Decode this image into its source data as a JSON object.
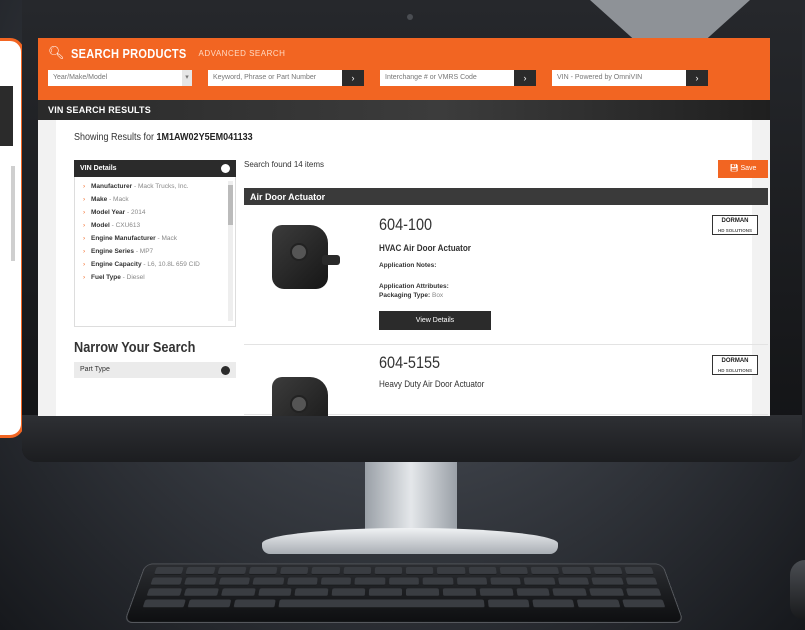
{
  "search": {
    "title": "SEARCH PRODUCTS",
    "advanced_label": "ADVANCED SEARCH",
    "ymm_placeholder": "Year/Make/Model",
    "keyword_placeholder": "Keyword, Phrase or Part Number",
    "interchange_placeholder": "Interchange # or VMRS Code",
    "vin_placeholder": "VIN - Powered by OmniVIN",
    "go_label": "›"
  },
  "results_strip": "VIN SEARCH RESULTS",
  "showing": {
    "prefix": "Showing Results for",
    "vin": "1M1AW02Y5EM041133"
  },
  "vin_details": {
    "title": "VIN Details",
    "items": [
      {
        "label": "Manufacturer",
        "value": "- Mack Trucks, Inc."
      },
      {
        "label": "Make",
        "value": "- Mack"
      },
      {
        "label": "Model Year",
        "value": "- 2014"
      },
      {
        "label": "Model",
        "value": "- CXU613"
      },
      {
        "label": "Engine Manufacturer",
        "value": "- Mack"
      },
      {
        "label": "Engine Series",
        "value": "- MP7"
      },
      {
        "label": "Engine Capacity",
        "value": "- L6, 10.8L 659 CID"
      },
      {
        "label": "Fuel Type",
        "value": "- Diesel"
      }
    ]
  },
  "narrow": {
    "title": "Narrow Your Search",
    "part_type_label": "Part Type"
  },
  "results": {
    "found_text": "Search found 14 items",
    "save_label": "Save",
    "category": "Air Door Actuator",
    "products": [
      {
        "number": "604-100",
        "name": "HVAC Air Door Actuator",
        "notes_label": "Application Notes:",
        "attributes_label": "Application Attributes:",
        "packaging_label": "Packaging Type:",
        "packaging_value": "Box",
        "view_label": "View Details",
        "brand": "DORMAN",
        "brand_sub": "HD SOLUTIONS"
      },
      {
        "number": "604-5155",
        "name": "Heavy Duty Air Door Actuator",
        "brand": "DORMAN",
        "brand_sub": "HD SOLUTIONS"
      }
    ]
  }
}
